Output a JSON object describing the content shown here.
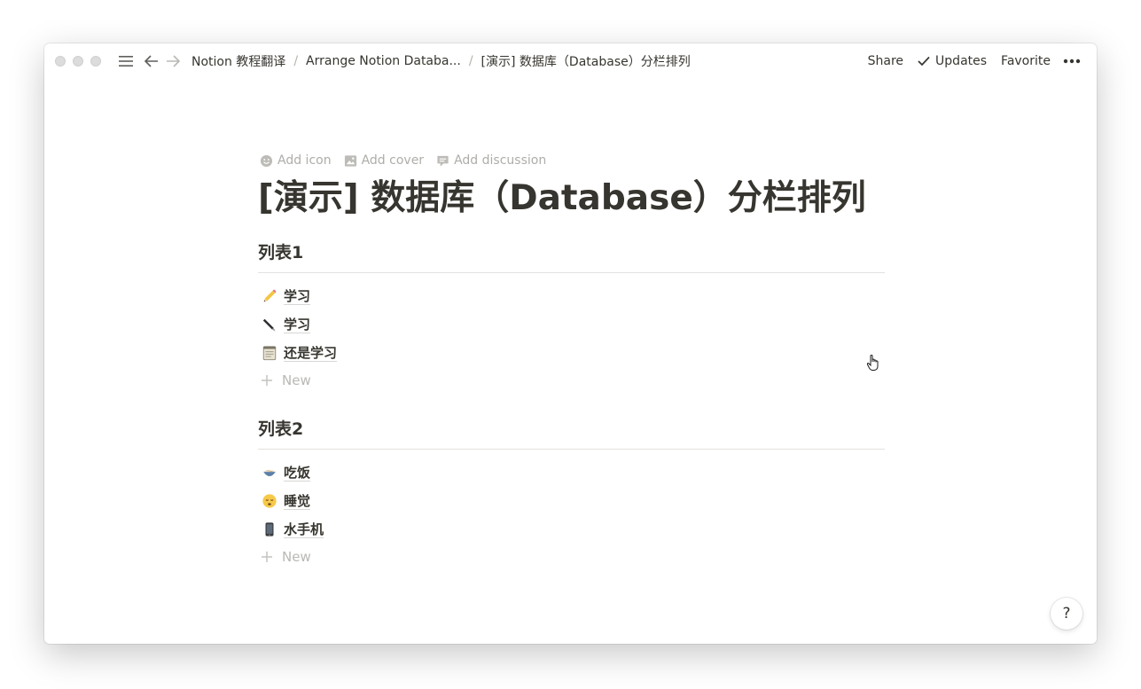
{
  "topbar": {
    "breadcrumb": [
      {
        "label": "Notion 教程翻译"
      },
      {
        "label": "Arrange Notion Databa..."
      },
      {
        "label": "[演示] 数据库（Database）分栏排列"
      }
    ],
    "share_label": "Share",
    "updates_label": "Updates",
    "favorite_label": "Favorite"
  },
  "page": {
    "actions": {
      "add_icon": "Add icon",
      "add_cover": "Add cover",
      "add_discussion": "Add discussion"
    },
    "title": "[演示] 数据库（Database）分栏排列",
    "sections": [
      {
        "title": "列表1",
        "items": [
          {
            "icon": "pencil-icon",
            "label": "学习"
          },
          {
            "icon": "pen-icon",
            "label": "学习"
          },
          {
            "icon": "notepad-icon",
            "label": "还是学习"
          }
        ],
        "new_label": "New"
      },
      {
        "title": "列表2",
        "items": [
          {
            "icon": "bowl-icon",
            "label": "吃饭"
          },
          {
            "icon": "sleeping-face-icon",
            "label": "睡觉"
          },
          {
            "icon": "mobile-phone-icon",
            "label": "水手机"
          }
        ],
        "new_label": "New"
      }
    ]
  },
  "help": {
    "label": "?"
  }
}
